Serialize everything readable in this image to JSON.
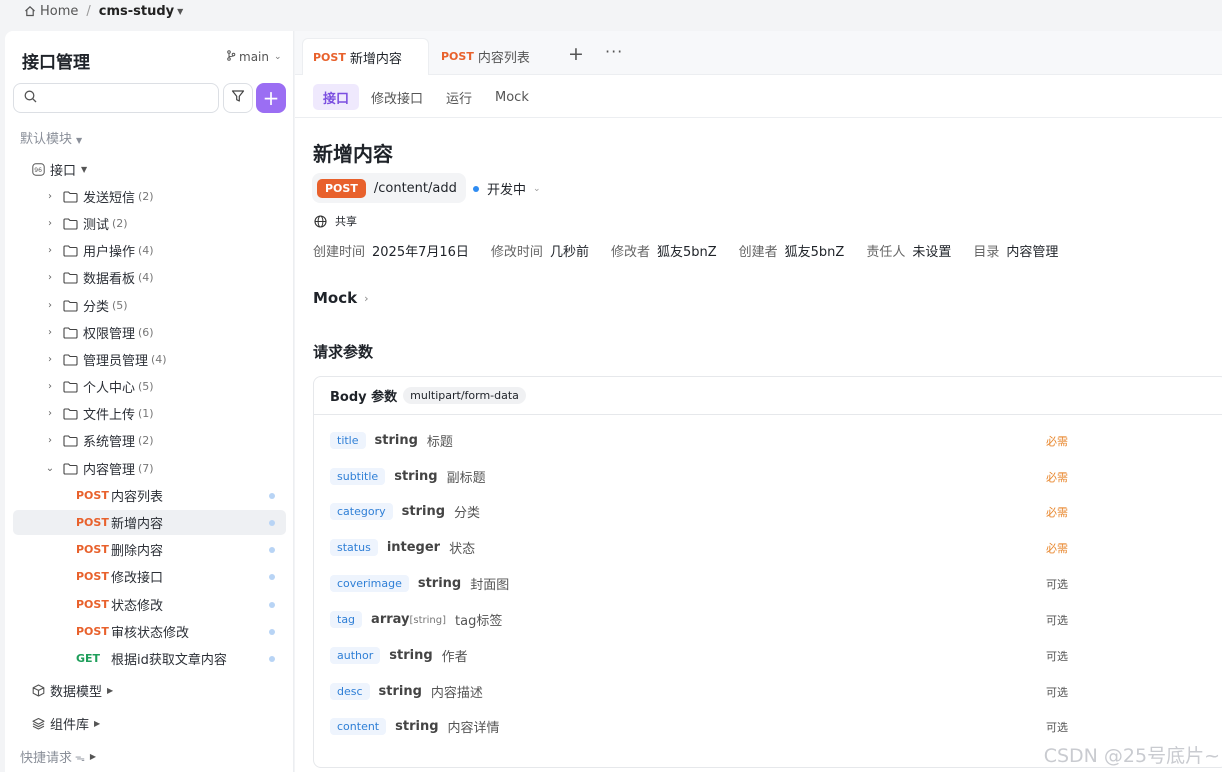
{
  "breadcrumb": {
    "home": "Home",
    "separator": "/",
    "project": "cms-study"
  },
  "sidebar": {
    "title": "接口管理",
    "branch": "main",
    "search_placeholder": "",
    "module": "默认模块",
    "root": "接口",
    "folders": [
      {
        "name": "发送短信",
        "count": "(2)"
      },
      {
        "name": "测试",
        "count": "(2)"
      },
      {
        "name": "用户操作",
        "count": "(4)"
      },
      {
        "name": "数据看板",
        "count": "(4)"
      },
      {
        "name": "分类",
        "count": "(5)"
      },
      {
        "name": "权限管理",
        "count": "(6)"
      },
      {
        "name": "管理员管理",
        "count": "(4)"
      },
      {
        "name": "个人中心",
        "count": "(5)"
      },
      {
        "name": "文件上传",
        "count": "(1)"
      },
      {
        "name": "系统管理",
        "count": "(2)"
      },
      {
        "name": "内容管理",
        "count": "(7)"
      }
    ],
    "endpoints": [
      {
        "method": "POST",
        "name": "内容列表"
      },
      {
        "method": "POST",
        "name": "新增内容"
      },
      {
        "method": "POST",
        "name": "删除内容"
      },
      {
        "method": "POST",
        "name": "修改接口"
      },
      {
        "method": "POST",
        "name": "状态修改"
      },
      {
        "method": "POST",
        "name": "审核状态修改"
      },
      {
        "method": "GET",
        "name": "根据id获取文章内容"
      }
    ],
    "data_model": "数据模型",
    "components": "组件库",
    "quick_request": "快捷请求"
  },
  "tabs": [
    {
      "method": "POST",
      "label": "新增内容"
    },
    {
      "method": "POST",
      "label": "内容列表"
    }
  ],
  "tab_plus": "+",
  "tab_more": "···",
  "subtabs": [
    "接口",
    "修改接口",
    "运行",
    "Mock"
  ],
  "endpoint": {
    "title": "新增内容",
    "method": "POST",
    "path": "/content/add",
    "status": "开发中",
    "share": "共享"
  },
  "meta": [
    {
      "key": "创建时间",
      "value": "2025年7月16日"
    },
    {
      "key": "修改时间",
      "value": "几秒前"
    },
    {
      "key": "修改者",
      "value": "狐友5bnZ"
    },
    {
      "key": "创建者",
      "value": "狐友5bnZ"
    },
    {
      "key": "责任人",
      "value": "未设置"
    },
    {
      "key": "目录",
      "value": "内容管理"
    }
  ],
  "mock_label": "Mock",
  "request_params_title": "请求参数",
  "body": {
    "title": "Body 参数",
    "content_type": "multipart/form-data",
    "params": [
      {
        "name": "title",
        "type": "string",
        "sub": "",
        "desc": "标题",
        "required": "必需"
      },
      {
        "name": "subtitle",
        "type": "string",
        "sub": "",
        "desc": "副标题",
        "required": "必需"
      },
      {
        "name": "category",
        "type": "string",
        "sub": "",
        "desc": "分类",
        "required": "必需"
      },
      {
        "name": "status",
        "type": "integer",
        "sub": "",
        "desc": "状态",
        "required": "必需"
      },
      {
        "name": "coverimage",
        "type": "string",
        "sub": "",
        "desc": "封面图",
        "required": "可选"
      },
      {
        "name": "tag",
        "type": "array",
        "sub": "[string]",
        "desc": "tag标签",
        "required": "可选"
      },
      {
        "name": "author",
        "type": "string",
        "sub": "",
        "desc": "作者",
        "required": "可选"
      },
      {
        "name": "desc",
        "type": "string",
        "sub": "",
        "desc": "内容描述",
        "required": "可选"
      },
      {
        "name": "content",
        "type": "string",
        "sub": "",
        "desc": "内容详情",
        "required": "可选"
      }
    ]
  },
  "watermark": "CSDN @25号底片~"
}
